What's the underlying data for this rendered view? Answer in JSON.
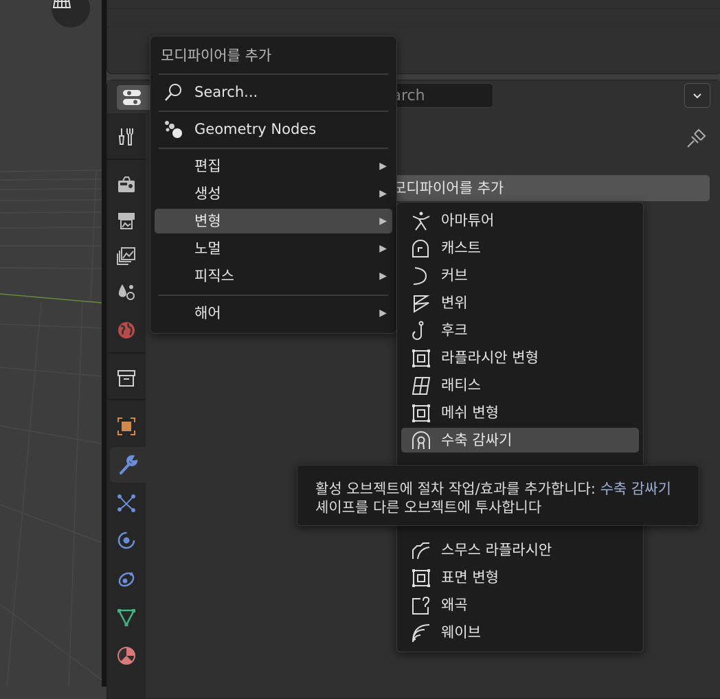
{
  "properties": {
    "search_placeholder": "Search",
    "add_modifier_button": "모디파이어를 추가"
  },
  "menu": {
    "title": "모디파이어를 추가",
    "search": "Search...",
    "geometry_nodes": "Geometry Nodes",
    "categories": [
      {
        "label": "편집"
      },
      {
        "label": "생성"
      },
      {
        "label": "변형"
      },
      {
        "label": "노멀"
      },
      {
        "label": "피직스"
      },
      {
        "label": "해어"
      }
    ]
  },
  "submenu": {
    "items": [
      {
        "label": "아마튜어",
        "icon": "armature-icon"
      },
      {
        "label": "캐스트",
        "icon": "cast-icon"
      },
      {
        "label": "커브",
        "icon": "curve-icon"
      },
      {
        "label": "변위",
        "icon": "displace-icon"
      },
      {
        "label": "후크",
        "icon": "hook-icon"
      },
      {
        "label": "라플라시안 변형",
        "icon": "laplacian-deform-icon"
      },
      {
        "label": "래티스",
        "icon": "lattice-icon"
      },
      {
        "label": "메쉬 변형",
        "icon": "mesh-deform-icon"
      },
      {
        "label": "수축 감싸기",
        "icon": "shrinkwrap-icon"
      },
      {
        "label": "스무스 라플라시안",
        "icon": "laplacian-smooth-icon"
      },
      {
        "label": "표면 변형",
        "icon": "surface-deform-icon"
      },
      {
        "label": "왜곡",
        "icon": "warp-icon"
      },
      {
        "label": "웨이브",
        "icon": "wave-icon"
      }
    ]
  },
  "tooltip": {
    "prefix": "활성 오브젝트에 절차 작업/효과를 추가합니다: ",
    "name": "수축 감싸기",
    "description": "셰이프를 다른 오브젝트에 투사합니다"
  },
  "colors": {
    "highlight": "#484848",
    "tooltip_name": "#9fb0d8",
    "active_tab_wrench": "#6a8fd8"
  }
}
